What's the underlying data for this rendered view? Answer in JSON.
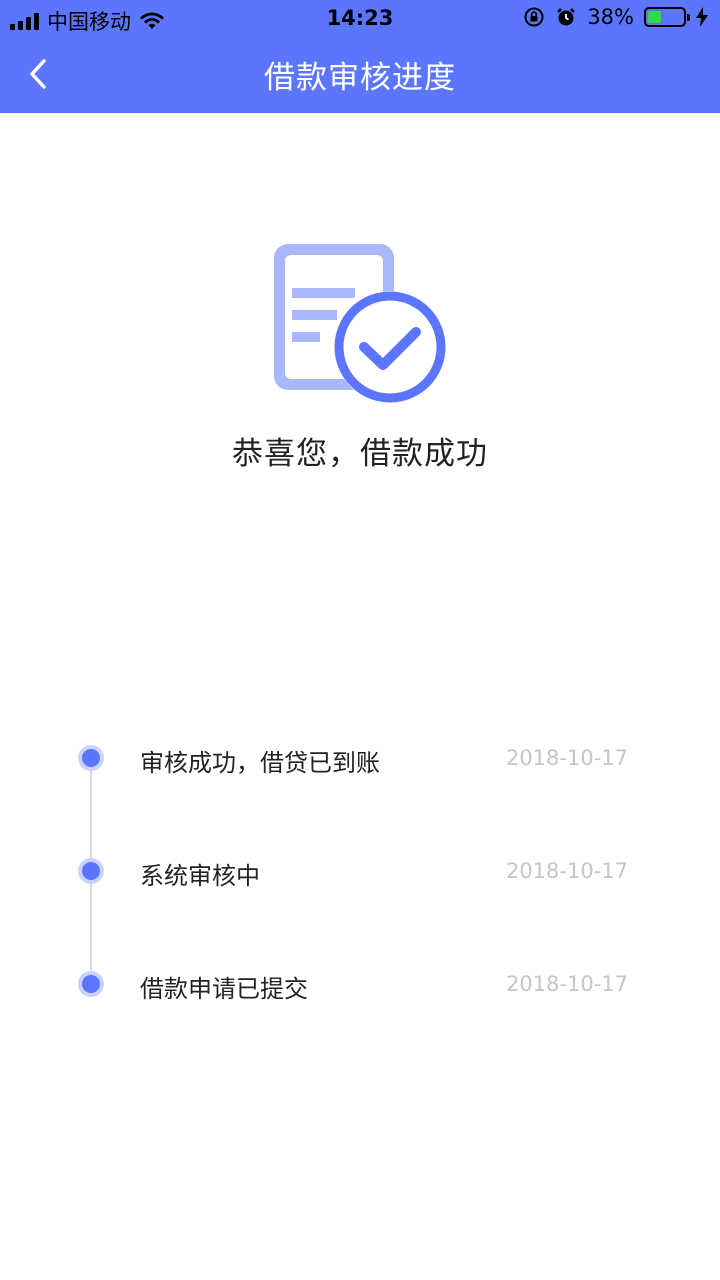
{
  "status_bar": {
    "carrier": "中国移动",
    "time": "14:23",
    "battery_percent": "38%",
    "battery_level": 0.38,
    "wifi_icon": "wifi-icon",
    "alarm_icon": "alarm-icon",
    "rotation_lock_icon": "rotation-lock-icon",
    "charging_icon": "charging-bolt-icon"
  },
  "nav": {
    "title": "借款审核进度",
    "back_icon": "chevron-left-icon"
  },
  "hero": {
    "icon": "document-check-icon",
    "message": "恭喜您，借款成功"
  },
  "timeline": {
    "items": [
      {
        "label": "审核成功，借贷已到账",
        "date": "2018-10-17"
      },
      {
        "label": "系统审核中",
        "date": "2018-10-17"
      },
      {
        "label": "借款申请已提交",
        "date": "2018-10-17"
      }
    ]
  },
  "colors": {
    "accent": "#5b76fc",
    "accent_light": "#a9b7fd",
    "text": "#222222",
    "date_text": "#c4c6cc"
  }
}
